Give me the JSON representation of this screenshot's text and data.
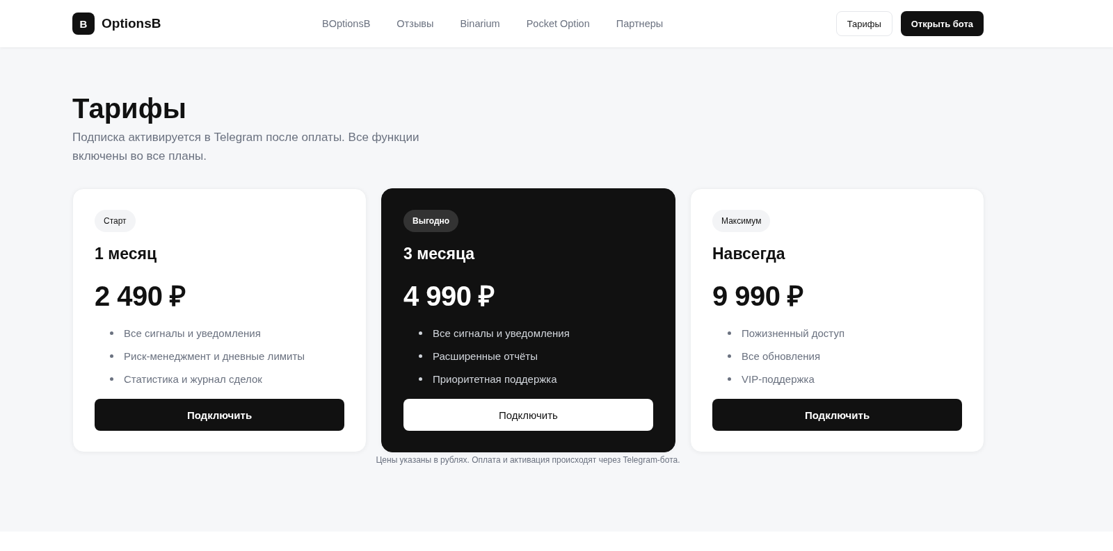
{
  "header": {
    "logo_mark": "B",
    "brand": "OptionsB",
    "nav": [
      {
        "label": "BOptionsB"
      },
      {
        "label": "Отзывы"
      },
      {
        "label": "Binarium"
      },
      {
        "label": "Pocket Option"
      },
      {
        "label": "Партнеры"
      }
    ],
    "tariffs_button": "Тарифы",
    "open_bot_button": "Открыть бота"
  },
  "page": {
    "title": "Тарифы",
    "subtitle": "Подписка активируется в Telegram после оплаты. Все функции включены во все планы.",
    "plans": [
      {
        "badge": "Старт",
        "name": "1 месяц",
        "price": "2 490 ₽",
        "featured": false,
        "features": [
          "Все сигналы и уведомления",
          "Риск-менеджмент и дневные лимиты",
          "Статистика и журнал сделок"
        ],
        "button": "Подключить"
      },
      {
        "badge": "Выгодно",
        "name": "3 месяца",
        "price": "4 990 ₽",
        "featured": true,
        "features": [
          "Все сигналы и уведомления",
          "Расширенные отчёты",
          "Приоритетная поддержка"
        ],
        "button": "Подключить"
      },
      {
        "badge": "Максимум",
        "name": "Навсегда",
        "price": "9 990 ₽",
        "featured": false,
        "features": [
          "Пожизненный доступ",
          "Все обновления",
          "VIP-поддержка"
        ],
        "button": "Подключить"
      }
    ],
    "note": "Цены указаны в рублях. Оплата и активация происходят через Telegram-бота."
  }
}
